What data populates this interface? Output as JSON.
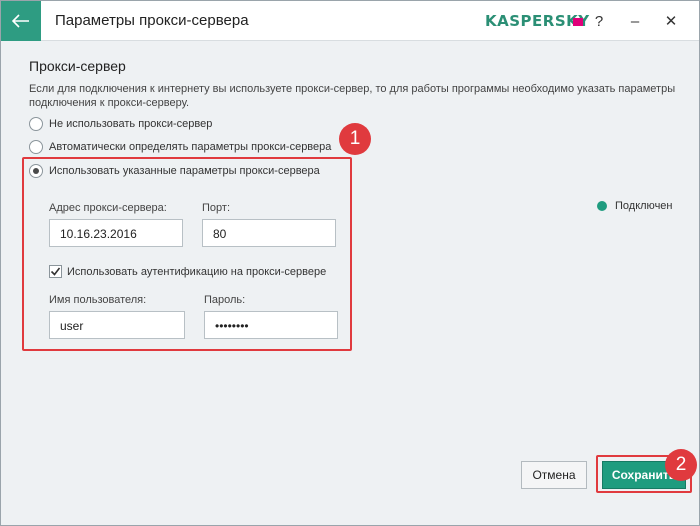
{
  "window": {
    "title": "Параметры прокси-сервера",
    "logo_text": "KASPERSKY",
    "help_label": "?",
    "minimize_label": "–",
    "close_label": "✕"
  },
  "section": {
    "title": "Прокси-сервер",
    "description": "Если для подключения к интернету вы используете прокси-сервер, то для работы программы необходимо указать параметры подключения к прокси-серверу."
  },
  "options": [
    {
      "label": "Не использовать прокси-сервер",
      "checked": false
    },
    {
      "label": "Автоматически определять параметры прокси-сервера",
      "checked": false
    },
    {
      "label": "Использовать указанные параметры прокси-сервера",
      "checked": true
    }
  ],
  "proxy": {
    "address_label": "Адрес прокси-сервера:",
    "address_value": "10.16.23.2016",
    "port_label": "Порт:",
    "port_value": "80",
    "auth_label": "Использовать аутентификацию на прокси-сервере",
    "auth_checked": true,
    "username_label": "Имя пользователя:",
    "username_value": "user",
    "password_label": "Пароль:",
    "password_value": "••••••••"
  },
  "status": {
    "label": "Подключен",
    "color": "#1f9c7f"
  },
  "markers": {
    "first": "1",
    "second": "2"
  },
  "buttons": {
    "cancel": "Отмена",
    "save": "Сохранить"
  },
  "colors": {
    "accent": "#2e9c82",
    "highlight": "#e03a3e",
    "save_button": "#1f9c7f"
  }
}
